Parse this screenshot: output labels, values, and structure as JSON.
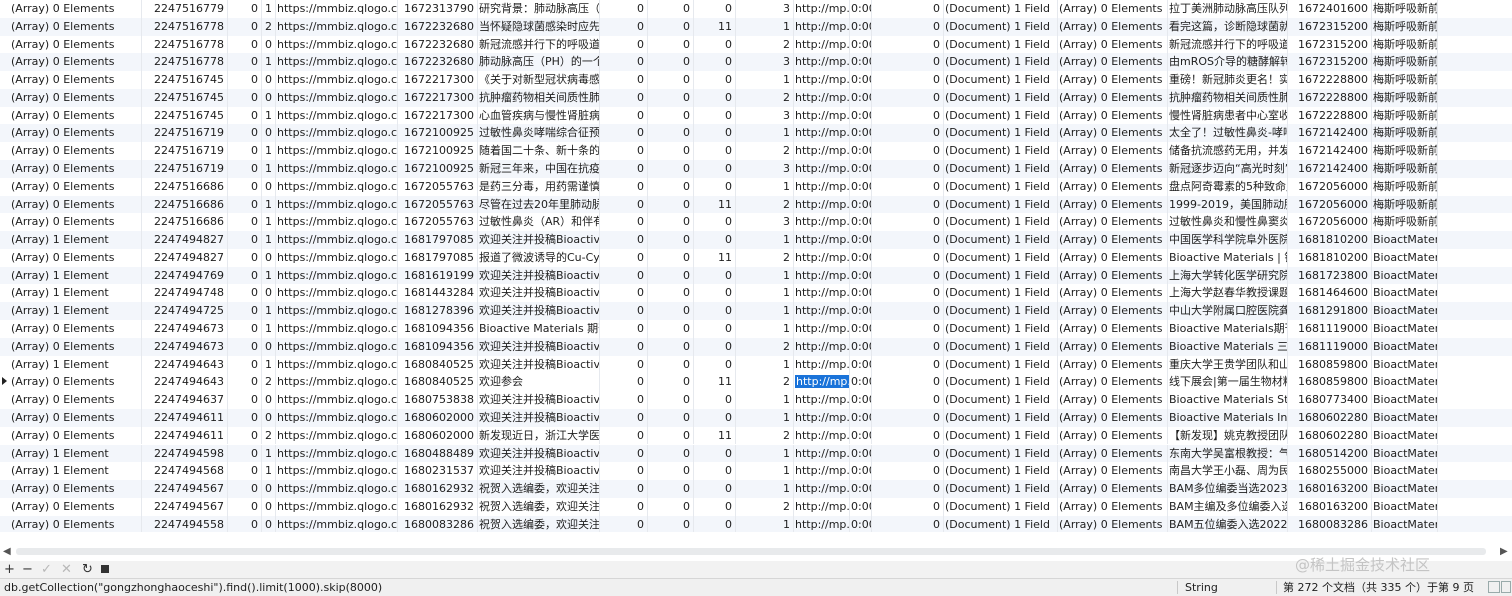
{
  "table": {
    "rows": [
      {
        "c": [
          "(Array) 0 Elements",
          "2247516779",
          "0",
          "1",
          "https://mmbiz.qlogo.cn/m",
          "1672313790",
          "研究背景：肺动脉高压（PA",
          "0",
          "0",
          "0",
          "3",
          "http://mp.w",
          "0:00",
          "0",
          "(Document) 1 Field",
          "(Array) 0 Elements",
          "拉丁美洲肺动脉高压队列中各",
          "1672401600",
          "梅斯呼吸新前沿"
        ]
      },
      {
        "c": [
          "(Array) 0 Elements",
          "2247516778",
          "0",
          "2",
          "https://mmbiz.qlogo.cn/m",
          "1672232680",
          "当怀疑隐球菌感染时应先分",
          "0",
          "0",
          "11",
          "1",
          "http://mp.w",
          "0:00",
          "0",
          "(Document) 1 Field",
          "(Array) 0 Elements",
          "看完这篇，诊断隐球菌就会",
          "1672315200",
          "梅斯呼吸新前沿"
        ]
      },
      {
        "c": [
          "(Array) 0 Elements",
          "2247516778",
          "0",
          "0",
          "https://mmbiz.qlogo.cn/m",
          "1672232680",
          "新冠流感并行下的呼吸道感染",
          "0",
          "0",
          "0",
          "2",
          "http://mp.w",
          "0:00",
          "0",
          "(Document) 1 Field",
          "(Array) 0 Elements",
          "新冠流感并行下的呼吸道感染",
          "1672315200",
          "梅斯呼吸新前沿"
        ]
      },
      {
        "c": [
          "(Array) 0 Elements",
          "2247516778",
          "0",
          "1",
          "https://mmbiz.qlogo.cn/m",
          "1672232680",
          "肺动脉高压（PH）的一个显",
          "0",
          "0",
          "0",
          "3",
          "http://mp.w",
          "0:00",
          "0",
          "(Document) 1 Field",
          "(Array) 0 Elements",
          "由mROS介导的糖酵解转移",
          "1672315200",
          "梅斯呼吸新前沿"
        ]
      },
      {
        "c": [
          "(Array) 0 Elements",
          "2247516745",
          "0",
          "0",
          "https://mmbiz.qlogo.cn/m",
          "1672217300",
          "《关于对新型冠状病毒感染",
          "0",
          "0",
          "0",
          "1",
          "http://mp.w",
          "0:00",
          "0",
          "(Document) 1 Field",
          "(Array) 0 Elements",
          "重磅！新冠肺炎更名！实施",
          "1672228800",
          "梅斯呼吸新前沿"
        ]
      },
      {
        "c": [
          "(Array) 0 Elements",
          "2247516745",
          "0",
          "0",
          "https://mmbiz.qlogo.cn/m",
          "1672217300",
          "抗肿瘤药物相关间质性肺病",
          "0",
          "0",
          "0",
          "2",
          "http://mp.w",
          "0:00",
          "0",
          "(Document) 1 Field",
          "(Array) 0 Elements",
          "抗肿瘤药物相关间质性肺病",
          "1672228800",
          "梅斯呼吸新前沿"
        ]
      },
      {
        "c": [
          "(Array) 0 Elements",
          "2247516745",
          "0",
          "1",
          "https://mmbiz.qlogo.cn/m",
          "1672217300",
          "心血管疾病与慢性肾脏病人群",
          "0",
          "0",
          "0",
          "3",
          "http://mp.w",
          "0:00",
          "0",
          "(Document) 1 Field",
          "(Array) 0 Elements",
          "慢性肾脏病患者中心室收缩",
          "1672228800",
          "梅斯呼吸新前沿"
        ]
      },
      {
        "c": [
          "(Array) 0 Elements",
          "2247516719",
          "0",
          "0",
          "https://mmbiz.qlogo.cn/m",
          "1672100925",
          "过敏性鼻炎哮喘综合征预防",
          "0",
          "0",
          "0",
          "1",
          "http://mp.w",
          "0:00",
          "0",
          "(Document) 1 Field",
          "(Array) 0 Elements",
          "太全了！过敏性鼻炎-哮喘综",
          "1672142400",
          "梅斯呼吸新前沿"
        ]
      },
      {
        "c": [
          "(Array) 0 Elements",
          "2247516719",
          "0",
          "1",
          "https://mmbiz.qlogo.cn/m",
          "1672100925",
          "随着国二十条、新十条的先后",
          "0",
          "0",
          "0",
          "2",
          "http://mp.w",
          "0:00",
          "0",
          "(Document) 1 Field",
          "(Array) 0 Elements",
          "储备抗流感药无用，并发症椎",
          "1672142400",
          "梅斯呼吸新前沿"
        ]
      },
      {
        "c": [
          "(Array) 0 Elements",
          "2247516719",
          "0",
          "1",
          "https://mmbiz.qlogo.cn/m",
          "1672100925",
          "新冠三年来，中国在抗疫上付",
          "0",
          "0",
          "0",
          "3",
          "http://mp.w",
          "0:00",
          "0",
          "(Document) 1 Field",
          "(Array) 0 Elements",
          "新冠逐步迈向“高光时刻”，",
          "1672142400",
          "梅斯呼吸新前沿"
        ]
      },
      {
        "c": [
          "(Array) 0 Elements",
          "2247516686",
          "0",
          "0",
          "https://mmbiz.qlogo.cn/m",
          "1672055763",
          "是药三分毒，用药需谨慎。通",
          "0",
          "0",
          "0",
          "1",
          "http://mp.w",
          "0:00",
          "0",
          "(Document) 1 Field",
          "(Array) 0 Elements",
          "盘点阿奇霉素的5种致命用法",
          "1672056000",
          "梅斯呼吸新前沿"
        ]
      },
      {
        "c": [
          "(Array) 0 Elements",
          "2247516686",
          "0",
          "1",
          "https://mmbiz.qlogo.cn/m",
          "1672055763",
          "尽管在过去20年里肺动脉高压",
          "0",
          "0",
          "11",
          "2",
          "http://mp.w",
          "0:00",
          "0",
          "(Document) 1 Field",
          "(Array) 0 Elements",
          "1999-2019，美国肺动脉高压",
          "1672056000",
          "梅斯呼吸新前沿"
        ]
      },
      {
        "c": [
          "(Array) 0 Elements",
          "2247516686",
          "0",
          "1",
          "https://mmbiz.qlogo.cn/m",
          "1672055763",
          "过敏性鼻炎（AR）和伴有鼻",
          "0",
          "0",
          "0",
          "3",
          "http://mp.w",
          "0:00",
          "0",
          "(Document) 1 Field",
          "(Array) 0 Elements",
          "过敏性鼻炎和慢性鼻窦炎患者",
          "1672056000",
          "梅斯呼吸新前沿"
        ]
      },
      {
        "c": [
          "(Array) 1 Element",
          "2247494827",
          "0",
          "1",
          "https://mmbiz.qlogo.cn/m",
          "1681797085",
          "欢迎关注并投稿Bioactive M",
          "0",
          "0",
          "0",
          "1",
          "http://mp.w",
          "0:00",
          "0",
          "(Document) 1 Field",
          "(Array) 0 Elements",
          "中国医学科学院阜外医院潘湘",
          "1681810200",
          "BioactMaterials"
        ]
      },
      {
        "c": [
          "(Array) 0 Elements",
          "2247494827",
          "0",
          "0",
          "https://mmbiz.qlogo.cn/m",
          "1681797085",
          "报道了微波诱导的Cu-Cy纳米",
          "0",
          "0",
          "11",
          "2",
          "http://mp.w",
          "0:00",
          "0",
          "(Document) 1 Field",
          "(Array) 0 Elements",
          "Bioactive Materials | 铜半胱",
          "1681810200",
          "BioactMaterials"
        ]
      },
      {
        "c": [
          "(Array) 1 Element",
          "2247494769",
          "0",
          "1",
          "https://mmbiz.qlogo.cn/m",
          "1681619199",
          "欢迎关注并投稿Bioactive M",
          "0",
          "0",
          "0",
          "1",
          "http://mp.w",
          "0:00",
          "0",
          "(Document) 1 Field",
          "(Array) 0 Elements",
          "上海大学转化医学研究院苏佳",
          "1681723800",
          "BioactMaterials"
        ]
      },
      {
        "c": [
          "(Array) 1 Element",
          "2247494748",
          "0",
          "0",
          "https://mmbiz.qlogo.cn/m",
          "1681443284",
          "欢迎关注并投稿Bioactive M",
          "0",
          "0",
          "0",
          "1",
          "http://mp.w",
          "0:00",
          "0",
          "(Document) 1 Field",
          "(Array) 0 Elements",
          "上海大学赵春华教授课题组：",
          "1681464600",
          "BioactMaterials"
        ]
      },
      {
        "c": [
          "(Array) 1 Element",
          "2247494725",
          "0",
          "1",
          "https://mmbiz.qlogo.cn/m",
          "1681278396",
          "欢迎关注并投稿Bioactive M",
          "0",
          "0",
          "0",
          "1",
          "http://mp.w",
          "0:00",
          "0",
          "(Document) 1 Field",
          "(Array) 0 Elements",
          "中山大学附属口腔医院龚启梅",
          "1681291800",
          "BioactMaterials"
        ]
      },
      {
        "c": [
          "(Array) 0 Elements",
          "2247494673",
          "0",
          "1",
          "https://mmbiz.qlogo.cn/m",
          "1681094356",
          "Bioactive Materials 期刊作",
          "0",
          "0",
          "0",
          "1",
          "http://mp.w",
          "0:00",
          "0",
          "(Document) 1 Field",
          "(Array) 0 Elements",
          "Bioactive Materials期刊作者",
          "1681119000",
          "BioactMaterials"
        ]
      },
      {
        "c": [
          "(Array) 0 Elements",
          "2247494673",
          "0",
          "0",
          "https://mmbiz.qlogo.cn/m",
          "1681094356",
          "欢迎关注并投稿Bioactive M",
          "0",
          "0",
          "0",
          "2",
          "http://mp.w",
          "0:00",
          "0",
          "(Document) 1 Field",
          "(Array) 0 Elements",
          "Bioactive Materials 三位青年",
          "1681119000",
          "BioactMaterials"
        ]
      },
      {
        "c": [
          "(Array) 1 Element",
          "2247494643",
          "0",
          "1",
          "https://mmbiz.qlogo.cn/m",
          "1680840525",
          "欢迎关注并投稿Bioactive M",
          "0",
          "0",
          "0",
          "1",
          "http://mp.w",
          "0:00",
          "0",
          "(Document) 1 Field",
          "(Array) 0 Elements",
          "重庆大学王贵学团队和山东大",
          "1680859800",
          "BioactMaterials"
        ]
      },
      {
        "c": [
          "(Array) 0 Elements",
          "2247494643",
          "0",
          "2",
          "https://mmbiz.qlogo.cn/m",
          "1680840525",
          "欢迎参会",
          "0",
          "0",
          "11",
          "2",
          "http://mp.w",
          "0:00",
          "0",
          "(Document) 1 Field",
          "(Array) 0 Elements",
          "线下展会|第一届生物材料与",
          "1680859800",
          "BioactMaterials"
        ]
      },
      {
        "c": [
          "(Array) 0 Elements",
          "2247494637",
          "0",
          "0",
          "https://mmbiz.qlogo.cn/m",
          "1680753838",
          "欢迎关注并投稿Bioactive M",
          "0",
          "0",
          "0",
          "1",
          "http://mp.w",
          "0:00",
          "0",
          "(Document) 1 Field",
          "(Array) 0 Elements",
          "Bioactive Materials Studen",
          "1680773400",
          "BioactMaterials"
        ]
      },
      {
        "c": [
          "(Array) 0 Elements",
          "2247494611",
          "0",
          "0",
          "https://mmbiz.qlogo.cn/m",
          "1680602000",
          "欢迎关注并投稿Bioactive M",
          "0",
          "0",
          "0",
          "1",
          "http://mp.w",
          "0:00",
          "0",
          "(Document) 1 Field",
          "(Array) 0 Elements",
          "Bioactive Materials Innova",
          "1680602280",
          "BioactMaterials"
        ]
      },
      {
        "c": [
          "(Array) 0 Elements",
          "2247494611",
          "0",
          "2",
          "https://mmbiz.qlogo.cn/m",
          "1680602000",
          "新发现近日，浙江大学医学院",
          "0",
          "0",
          "11",
          "2",
          "http://mp.w",
          "0:00",
          "0",
          "(Document) 1 Field",
          "(Array) 0 Elements",
          "【新发现】姚克教授团队发现",
          "1680602280",
          "BioactMaterials"
        ]
      },
      {
        "c": [
          "(Array) 1 Element",
          "2247494598",
          "0",
          "1",
          "https://mmbiz.qlogo.cn/m",
          "1680488489",
          "欢迎关注并投稿Bioactive M",
          "0",
          "0",
          "0",
          "1",
          "http://mp.w",
          "0:00",
          "0",
          "(Document) 1 Field",
          "(Array) 0 Elements",
          "东南大学吴富根教授：气体递",
          "1680514200",
          "BioactMaterials"
        ]
      },
      {
        "c": [
          "(Array) 1 Element",
          "2247494568",
          "0",
          "1",
          "https://mmbiz.qlogo.cn/m",
          "1680231537",
          "欢迎关注并投稿Bioactive M",
          "0",
          "0",
          "0",
          "1",
          "http://mp.w",
          "0:00",
          "0",
          "(Document) 1 Field",
          "(Array) 0 Elements",
          "南昌大学王小磊、周为民团队",
          "1680255000",
          "BioactMaterials"
        ]
      },
      {
        "c": [
          "(Array) 0 Elements",
          "2247494567",
          "0",
          "0",
          "https://mmbiz.qlogo.cn/m",
          "1680162932",
          "祝贺入选编委，欢迎关注并投",
          "0",
          "0",
          "0",
          "1",
          "http://mp.w",
          "0:00",
          "0",
          "(Document) 1 Field",
          "(Array) 0 Elements",
          "BAM多位编委当选2023年美",
          "1680163200",
          "BioactMaterials"
        ]
      },
      {
        "c": [
          "(Array) 0 Elements",
          "2247494567",
          "0",
          "0",
          "https://mmbiz.qlogo.cn/m",
          "1680162932",
          "祝贺入选编委，欢迎关注并投",
          "0",
          "0",
          "0",
          "2",
          "http://mp.w",
          "0:00",
          "0",
          "(Document) 1 Field",
          "(Array) 0 Elements",
          "BAM主编及多位编委入选20",
          "1680163200",
          "BioactMaterials"
        ]
      },
      {
        "c": [
          "(Array) 0 Elements",
          "2247494558",
          "0",
          "0",
          "https://mmbiz.qlogo.cn/m",
          "1680083286",
          "祝贺入选编委，欢迎关注并投",
          "0",
          "0",
          "0",
          "1",
          "http://mp.w",
          "0:00",
          "0",
          "(Document) 1 Field",
          "(Array) 0 Elements",
          "BAM五位编委入选2022“中",
          "1680083286",
          "BioactMaterials"
        ]
      }
    ]
  },
  "toolbar": {
    "add_icon": "plus-icon",
    "remove_icon": "minus-icon",
    "apply_icon": "check-icon",
    "cancel_icon": "x-icon",
    "refresh_icon": "refresh-icon",
    "stop_icon": "stop-icon"
  },
  "status": {
    "query": "db.getCollection(\"gongzhonghaoceshi\").find().limit(1000).skip(8000)",
    "type": "String",
    "page_info": "第 272 个文档（共 335 个）于第 9 页"
  },
  "watermark": "@稀土掘金技术社区",
  "colors": {
    "selection": "#1a73d9",
    "row_alt": "#f3f6fb"
  }
}
